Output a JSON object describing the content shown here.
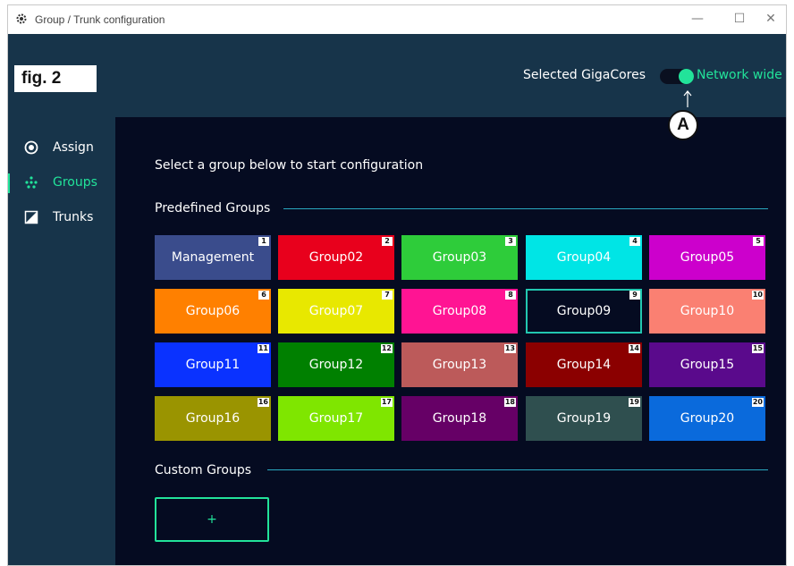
{
  "window": {
    "title": "Group / Trunk configuration",
    "controls": {
      "minimize": "—",
      "maximize": "☐",
      "close": "✕"
    }
  },
  "figure_label": "fig. 2",
  "callout_label": "A",
  "header": {
    "selected_label": "Selected GigaCores",
    "toggle_label": "Network wide",
    "toggle_on": true
  },
  "sidebar": {
    "items": [
      {
        "label": "Assign",
        "icon": "radio-target-icon",
        "active": false
      },
      {
        "label": "Groups",
        "icon": "dots-cluster-icon",
        "active": true
      },
      {
        "label": "Trunks",
        "icon": "half-square-icon",
        "active": false
      }
    ]
  },
  "main": {
    "hint": "Select a group below to start configuration",
    "predefined_title": "Predefined Groups",
    "custom_title": "Custom Groups",
    "add_label": "+"
  },
  "groups": [
    {
      "name": "Management",
      "num": "1",
      "color": "#3a4c8c"
    },
    {
      "name": "Group02",
      "num": "2",
      "color": "#e8001c"
    },
    {
      "name": "Group03",
      "num": "3",
      "color": "#2ecc3a"
    },
    {
      "name": "Group04",
      "num": "4",
      "color": "#00e5e5"
    },
    {
      "name": "Group05",
      "num": "5",
      "color": "#cc00cc"
    },
    {
      "name": "Group06",
      "num": "6",
      "color": "#ff8000"
    },
    {
      "name": "Group07",
      "num": "7",
      "color": "#e8e800"
    },
    {
      "name": "Group08",
      "num": "8",
      "color": "#ff1493"
    },
    {
      "name": "Group09",
      "num": "9",
      "color": "#050b21",
      "selected": true
    },
    {
      "name": "Group10",
      "num": "10",
      "color": "#fa8072"
    },
    {
      "name": "Group11",
      "num": "11",
      "color": "#0a32ff"
    },
    {
      "name": "Group12",
      "num": "12",
      "color": "#008000"
    },
    {
      "name": "Group13",
      "num": "13",
      "color": "#bc5a5a"
    },
    {
      "name": "Group14",
      "num": "14",
      "color": "#8b0000"
    },
    {
      "name": "Group15",
      "num": "15",
      "color": "#5a0a8c"
    },
    {
      "name": "Group16",
      "num": "16",
      "color": "#9a9400"
    },
    {
      "name": "Group17",
      "num": "17",
      "color": "#7fe600"
    },
    {
      "name": "Group18",
      "num": "18",
      "color": "#660066"
    },
    {
      "name": "Group19",
      "num": "19",
      "color": "#2f4f4f"
    },
    {
      "name": "Group20",
      "num": "20",
      "color": "#0a6adc"
    }
  ],
  "colors": {
    "accent": "#22e39a",
    "header_bg": "#17344a",
    "main_bg": "#050b21",
    "line": "#2aa9c0"
  }
}
